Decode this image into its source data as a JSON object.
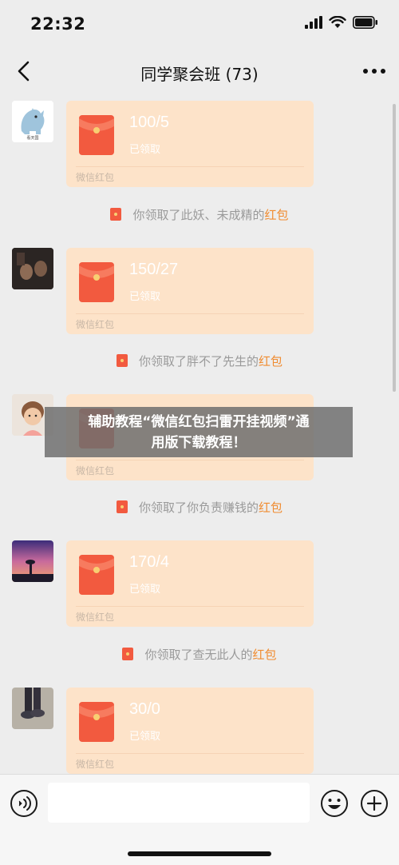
{
  "status_bar": {
    "time": "22:32"
  },
  "header": {
    "title": "同学聚会班 (73)"
  },
  "messages": [
    {
      "amount": "100/5",
      "status": "已领取",
      "footer": "微信红包",
      "sys_prefix": "你领取了此妖、未成精的",
      "sys_link": "红包"
    },
    {
      "amount": "150/27",
      "status": "已领取",
      "footer": "微信红包",
      "sys_prefix": "你领取了胖不了先生的",
      "sys_link": "红包"
    },
    {
      "amount": "",
      "status": "",
      "footer": "微信红包",
      "sys_prefix": "你领取了你负责赚钱的",
      "sys_link": "红包"
    },
    {
      "amount": "170/4",
      "status": "已领取",
      "footer": "微信红包",
      "sys_prefix": "你领取了查无此人的",
      "sys_link": "红包"
    },
    {
      "amount": "30/0",
      "status": "已领取",
      "footer": "微信红包",
      "sys_prefix": "",
      "sys_link": ""
    }
  ],
  "avatar1_caption": "看天国",
  "overlay": {
    "line1": "辅助教程“微信红包扫雷开挂视频”通",
    "line2": "用版下载教程！"
  },
  "input_bar": {
    "placeholder": ""
  },
  "colors": {
    "card_bg": "#fde3c9",
    "envelope": "#f25a3f",
    "link": "#f08c31"
  }
}
